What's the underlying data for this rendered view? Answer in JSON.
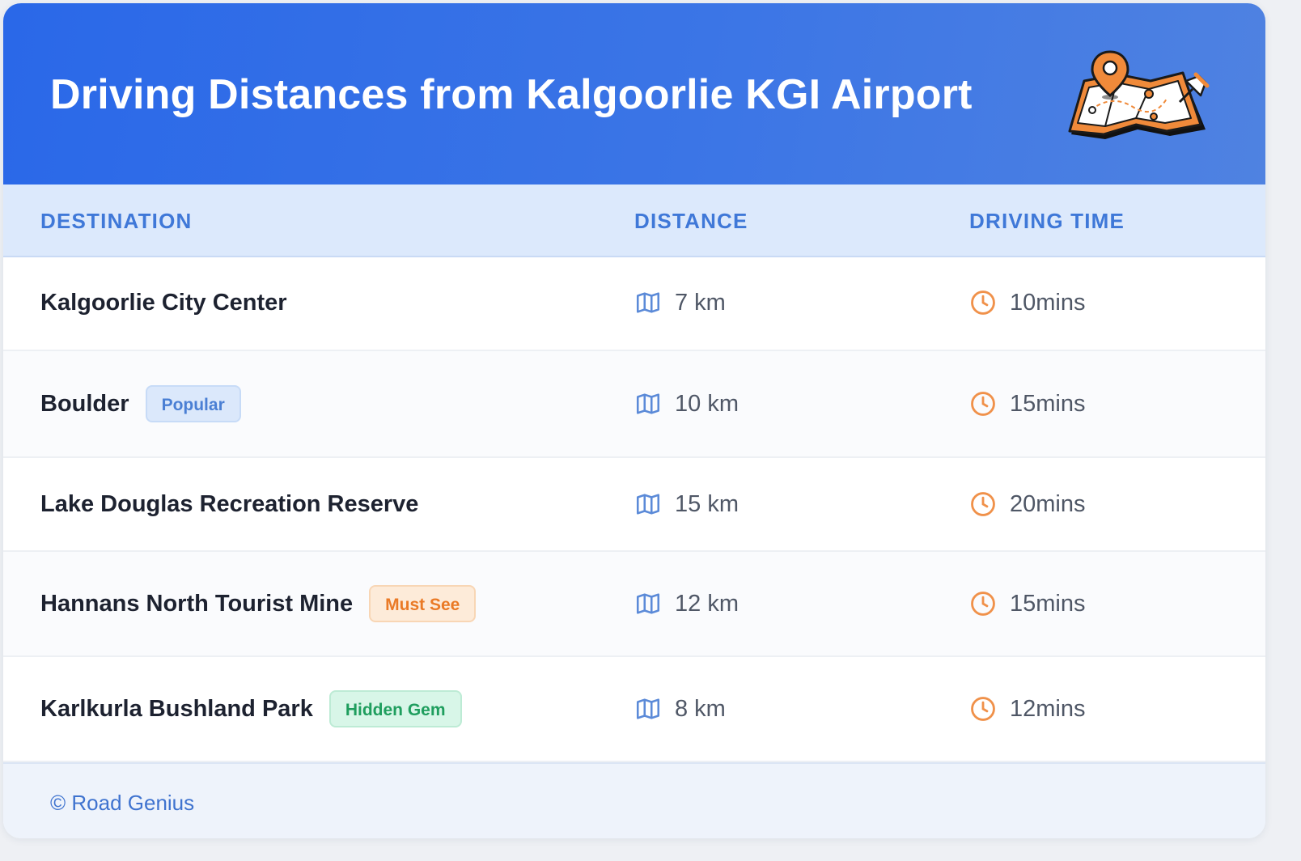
{
  "header": {
    "title": "Driving Distances from Kalgoorlie KGI Airport",
    "illustration": "folded-map-with-location-pins"
  },
  "table": {
    "columns": [
      "DESTINATION",
      "DISTANCE",
      "DRIVING TIME"
    ],
    "rows": [
      {
        "destination": "Kalgoorlie City Center",
        "badge": "",
        "badge_color": "",
        "distance": "7 km",
        "time": "10mins"
      },
      {
        "destination": "Boulder",
        "badge": "Popular",
        "badge_color": "blue",
        "distance": "10 km",
        "time": "15mins"
      },
      {
        "destination": "Lake Douglas Recreation Reserve",
        "badge": "",
        "badge_color": "",
        "distance": "15 km",
        "time": "20mins"
      },
      {
        "destination": "Hannans North Tourist Mine",
        "badge": "Must See",
        "badge_color": "orange",
        "distance": "12 km",
        "time": "15mins"
      },
      {
        "destination": "Karlkurla Bushland Park",
        "badge": "Hidden Gem",
        "badge_color": "green",
        "distance": "8 km",
        "time": "12mins"
      }
    ],
    "distance_icon": "map-icon",
    "time_icon": "clock-icon"
  },
  "footer": {
    "credit": "© Road Genius"
  },
  "colors": {
    "header_gradient_start": "#2a68e8",
    "header_gradient_end": "#4f82e1",
    "accent_blue": "#3f78d8",
    "accent_orange": "#ea7a26",
    "accent_green": "#1f9e5e"
  }
}
